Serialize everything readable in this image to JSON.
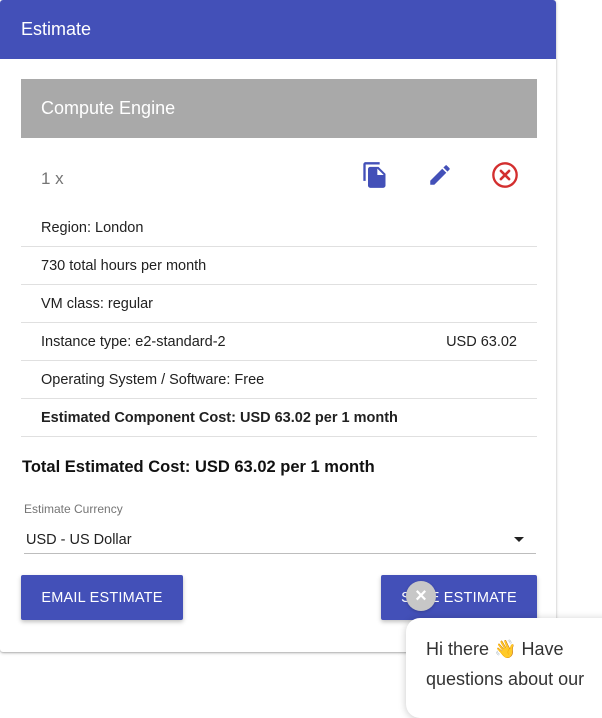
{
  "header": {
    "title": "Estimate"
  },
  "component": {
    "title": "Compute Engine",
    "quantity": "1 x",
    "icons": {
      "copy": "copy-icon",
      "edit": "edit-icon",
      "remove": "remove-circle-icon"
    },
    "details": [
      {
        "label": "Region: London",
        "value": ""
      },
      {
        "label": "730 total hours per month",
        "value": ""
      },
      {
        "label": "VM class: regular",
        "value": ""
      },
      {
        "label": "Instance type: e2-standard-2",
        "value": "USD 63.02"
      },
      {
        "label": "Operating System / Software: Free",
        "value": ""
      },
      {
        "label": "Estimated Component Cost: USD 63.02 per 1 month",
        "value": ""
      }
    ]
  },
  "total": "Total Estimated Cost: USD 63.02 per 1 month",
  "currency": {
    "label": "Estimate Currency",
    "value": "USD - US Dollar"
  },
  "buttons": {
    "email": "EMAIL ESTIMATE",
    "save": "SAVE ESTIMATE"
  },
  "chat": {
    "close": "×",
    "line1": "Hi there 👋 Have",
    "line2": "questions about our"
  },
  "colors": {
    "primary": "#4350b8",
    "header_gray": "#a9a9a9",
    "danger": "#d32f2f"
  }
}
